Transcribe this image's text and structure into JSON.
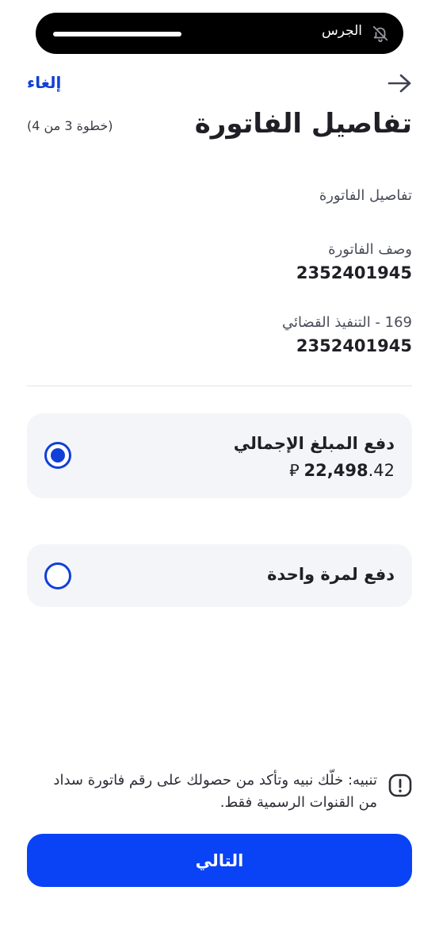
{
  "status": {
    "silent_label": "الجرس"
  },
  "header": {
    "cancel_label": "إلغاء",
    "title": "تفاصيل الفاتورة",
    "step": "(خطوة 3 من 4)"
  },
  "details": {
    "heading": "تفاصيل الفاتورة",
    "fields": [
      {
        "label": "وصف الفاتورة",
        "value": "2352401945"
      },
      {
        "label": "169 - التنفيذ القضائي",
        "value": "2352401945"
      }
    ]
  },
  "options": [
    {
      "title": "دفع المبلغ الإجمالي",
      "amount_integer": "22,498",
      "amount_decimal": ".42",
      "currency_symbol": "⃁",
      "selected": true
    },
    {
      "title": "دفع لمرة واحدة",
      "selected": false
    }
  ],
  "warning": {
    "text": "تنبيه: خلّك نبيه وتأكد من حصولك على رقم فاتورة سداد من القنوات الرسمية فقط."
  },
  "footer": {
    "next_label": "التالي"
  },
  "colors": {
    "accent": "#1140d8",
    "primary_button": "#0a43f5",
    "card_bg": "#f4f5f9"
  }
}
